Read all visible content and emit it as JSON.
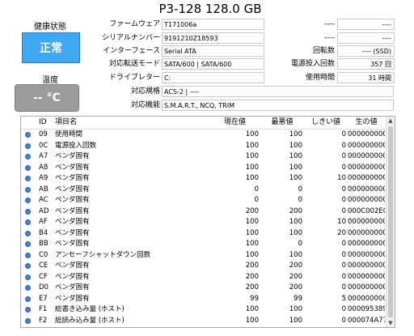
{
  "header": {
    "title": "P3-128 128.0 GB"
  },
  "status": {
    "health_label": "健康状態",
    "health_value": "正常",
    "temp_label": "温度",
    "temp_value": "-- °C",
    "health_color": "#3ea8f3",
    "temp_color": "#9c9c9c"
  },
  "info": {
    "firmware_label": "ファームウェア",
    "firmware": "T171006a",
    "serial_label": "シリアルナンバー",
    "serial": "9191210Z18593",
    "interface_label": "インターフェース",
    "interface": "Serial ATA",
    "transfer_label": "対応転送モード",
    "transfer": "SATA/600 | SATA/600",
    "drive_letter_label": "ドライブレター",
    "drive_letter": "C:",
    "standard_label": "対応規格",
    "standard": "ACS-2 | ----",
    "features_label": "対応機能",
    "features": "S.M.A.R.T., NCQ, TRIM"
  },
  "right_info": {
    "dash1_label": "----",
    "dash1": "----",
    "dash2_label": "----",
    "dash2": "----",
    "rpm_label": "回転数",
    "rpm": "---- (SSD)",
    "power_count_label": "電源投入回数",
    "power_count": "357 回",
    "hours_label": "使用時間",
    "hours": "31 時間"
  },
  "table": {
    "headers": {
      "id": "ID",
      "name": "項目名",
      "current": "現在値",
      "worst": "最悪値",
      "threshold": "しきい値",
      "raw": "生の値"
    },
    "rows": [
      {
        "id": "09",
        "name": "使用時間",
        "current": "100",
        "worst": "100",
        "threshold": "0",
        "raw": "00000000001F"
      },
      {
        "id": "0C",
        "name": "電源投入回数",
        "current": "100",
        "worst": "100",
        "threshold": "0",
        "raw": "000000000165"
      },
      {
        "id": "A7",
        "name": "ベンダ固有",
        "current": "100",
        "worst": "100",
        "threshold": "0",
        "raw": "000000000000"
      },
      {
        "id": "A8",
        "name": "ベンダ固有",
        "current": "100",
        "worst": "100",
        "threshold": "0",
        "raw": "000000000000"
      },
      {
        "id": "A9",
        "name": "ベンダ固有",
        "current": "100",
        "worst": "100",
        "threshold": "10",
        "raw": "000000000022"
      },
      {
        "id": "AB",
        "name": "ベンダ固有",
        "current": "0",
        "worst": "0",
        "threshold": "0",
        "raw": "000000000000"
      },
      {
        "id": "AC",
        "name": "ベンダ固有",
        "current": "0",
        "worst": "0",
        "threshold": "0",
        "raw": "000000000000"
      },
      {
        "id": "AD",
        "name": "ベンダ固有",
        "current": "200",
        "worst": "200",
        "threshold": "0",
        "raw": "000C002E0023"
      },
      {
        "id": "AF",
        "name": "ベンダ固有",
        "current": "100",
        "worst": "100",
        "threshold": "10",
        "raw": "000000000000"
      },
      {
        "id": "B4",
        "name": "ベンダ固有",
        "current": "100",
        "worst": "100",
        "threshold": "20",
        "raw": "000000000160"
      },
      {
        "id": "BB",
        "name": "ベンダ固有",
        "current": "100",
        "worst": "0",
        "threshold": "0",
        "raw": "000000000000"
      },
      {
        "id": "C0",
        "name": "アンセーフシャットダウン回数",
        "current": "100",
        "worst": "100",
        "threshold": "0",
        "raw": "00000000003A"
      },
      {
        "id": "CE",
        "name": "ベンダ固有",
        "current": "200",
        "worst": "200",
        "threshold": "0",
        "raw": "00000000000C"
      },
      {
        "id": "CF",
        "name": "ベンダ固有",
        "current": "200",
        "worst": "200",
        "threshold": "0",
        "raw": "00000000002E"
      },
      {
        "id": "D0",
        "name": "ベンダ固有",
        "current": "200",
        "worst": "200",
        "threshold": "0",
        "raw": "000000000023"
      },
      {
        "id": "E7",
        "name": "ベンダ固有",
        "current": "99",
        "worst": "99",
        "threshold": "5",
        "raw": "000000000001"
      },
      {
        "id": "F1",
        "name": "総書き込み量 (ホスト)",
        "current": "100",
        "worst": "100",
        "threshold": "0",
        "raw": "000095389722"
      },
      {
        "id": "F2",
        "name": "総読み込み量 (ホスト)",
        "current": "100",
        "worst": "100",
        "threshold": "0",
        "raw": "000074A77A09"
      }
    ]
  },
  "colors": {
    "status_dot": "#3a86d8"
  }
}
